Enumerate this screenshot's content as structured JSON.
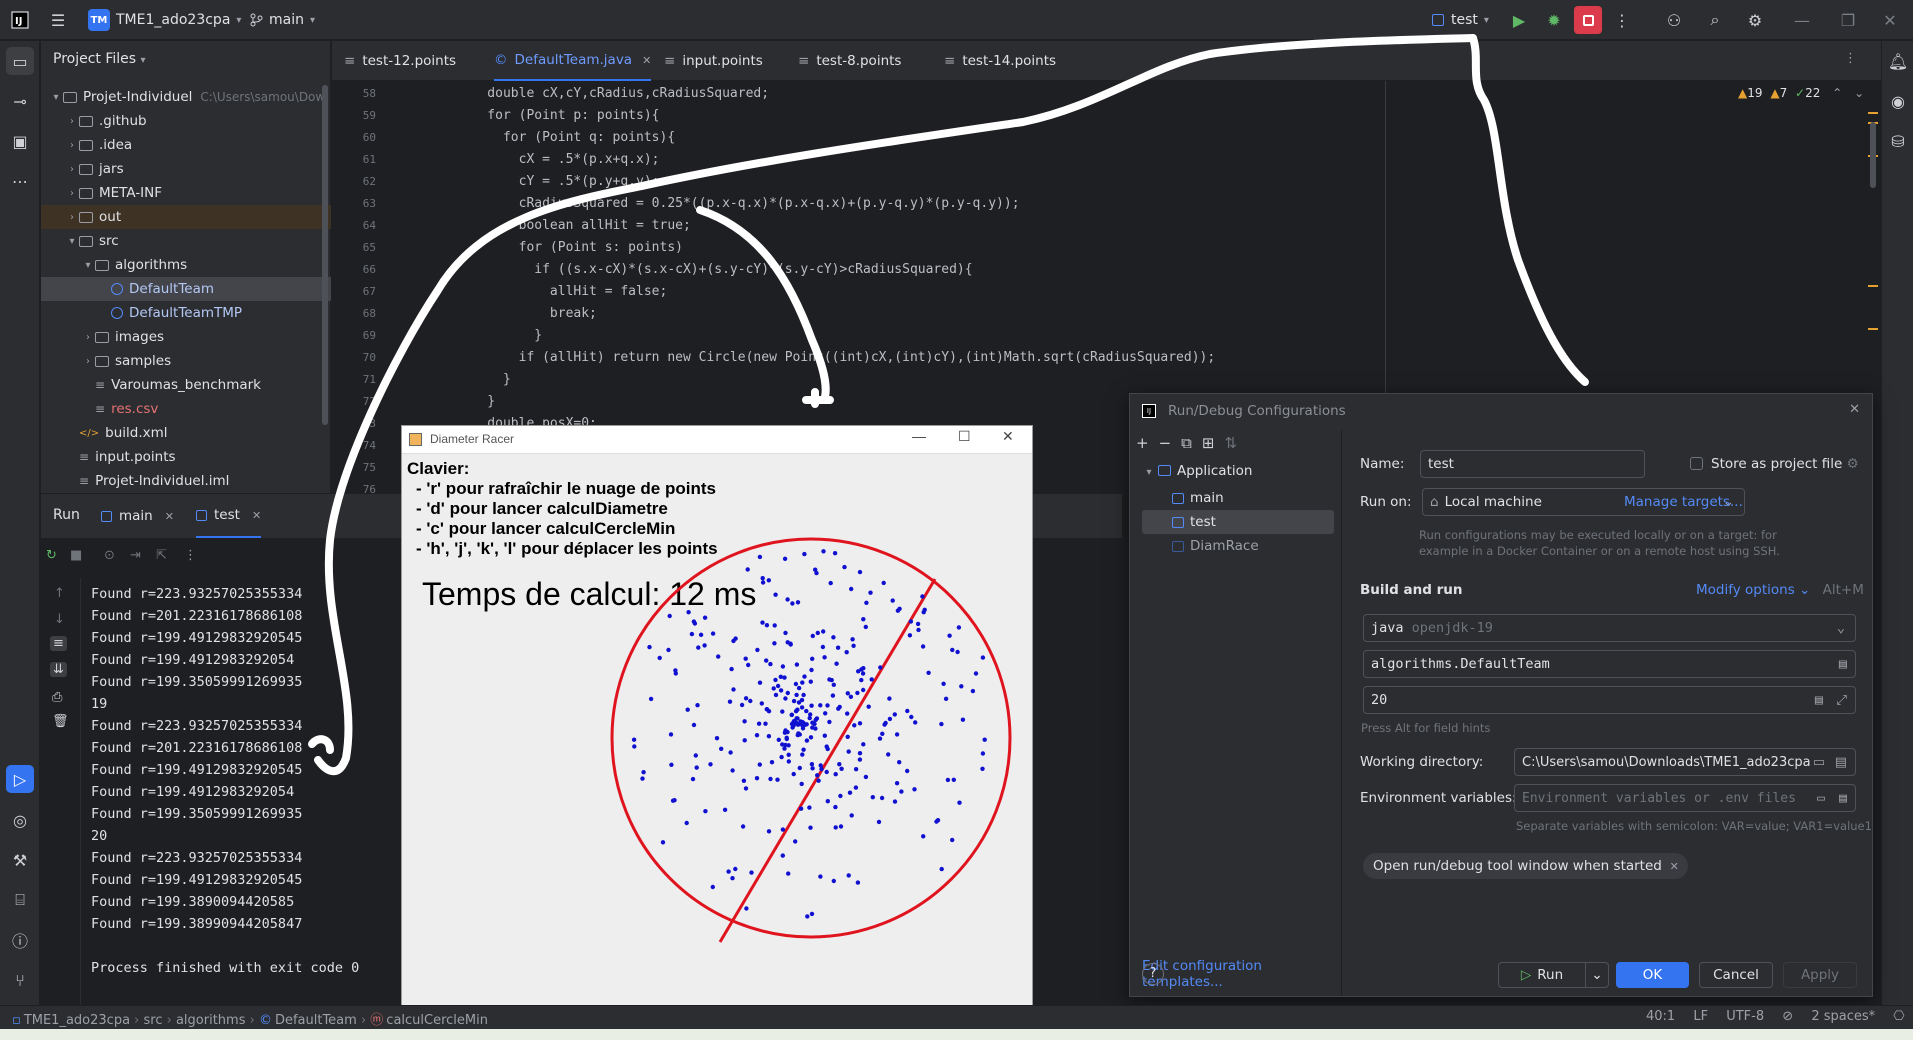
{
  "titlebar": {
    "project_badge": "TM",
    "project_name": "TME1_ado23cpa",
    "branch": "main",
    "run_config": "test",
    "icons": [
      "main-menu-icon",
      "branch-icon",
      "run-icon",
      "debug-icon",
      "stop-icon",
      "more-icon",
      "add-user-icon",
      "search-icon",
      "settings-icon",
      "minimize-icon",
      "maximize-icon",
      "close-icon"
    ]
  },
  "project_panel": {
    "title": "Project Files",
    "tree": [
      {
        "label": "Projet-Individuel",
        "extra": "C:\\Users\\samou\\Dow",
        "depth": 0,
        "kind": "folder",
        "open": true
      },
      {
        "label": ".github",
        "depth": 1,
        "kind": "folder",
        "open": false
      },
      {
        "label": ".idea",
        "depth": 1,
        "kind": "folder",
        "open": false
      },
      {
        "label": "jars",
        "depth": 1,
        "kind": "folder",
        "open": false
      },
      {
        "label": "META-INF",
        "depth": 1,
        "kind": "folder",
        "open": false
      },
      {
        "label": "out",
        "depth": 1,
        "kind": "folder",
        "open": false,
        "highlight": true
      },
      {
        "label": "src",
        "depth": 1,
        "kind": "folder",
        "open": true
      },
      {
        "label": "algorithms",
        "depth": 2,
        "kind": "folder",
        "open": true
      },
      {
        "label": "DefaultTeam",
        "depth": 3,
        "kind": "class",
        "selected": true
      },
      {
        "label": "DefaultTeamTMP",
        "depth": 3,
        "kind": "class"
      },
      {
        "label": "images",
        "depth": 2,
        "kind": "folder",
        "open": false
      },
      {
        "label": "samples",
        "depth": 2,
        "kind": "folder",
        "open": false
      },
      {
        "label": "Varoumas_benchmark",
        "depth": 2,
        "kind": "file"
      },
      {
        "label": "res.csv",
        "depth": 2,
        "kind": "csv"
      },
      {
        "label": "build.xml",
        "depth": 1,
        "kind": "xml"
      },
      {
        "label": "input.points",
        "depth": 1,
        "kind": "file"
      },
      {
        "label": "Projet-Individuel.iml",
        "depth": 1,
        "kind": "file"
      }
    ]
  },
  "editor": {
    "tabs": [
      "test-12.points",
      "DefaultTeam.java",
      "input.points",
      "test-8.points",
      "test-14.points"
    ],
    "active_tab": 1,
    "inspections": {
      "warnings": "19",
      "weak": "7",
      "typos": "22"
    },
    "lines": [
      {
        "n": "58",
        "text": "    double cX,cY,cRadius,cRadiusSquared;"
      },
      {
        "n": "59",
        "text": "    for (Point p: points){"
      },
      {
        "n": "60",
        "text": "      for (Point q: points){"
      },
      {
        "n": "61",
        "text": "        cX = .5*(p.x+q.x);"
      },
      {
        "n": "62",
        "text": "        cY = .5*(p.y+q.y);"
      },
      {
        "n": "63",
        "text": "        cRadiusSquared = 0.25*((p.x-q.x)*(p.x-q.x)+(p.y-q.y)*(p.y-q.y));"
      },
      {
        "n": "64",
        "text": "        boolean allHit = true;"
      },
      {
        "n": "65",
        "text": "        for (Point s: points)"
      },
      {
        "n": "66",
        "text": "          if ((s.x-cX)*(s.x-cX)+(s.y-cY)*(s.y-cY)>cRadiusSquared){"
      },
      {
        "n": "67",
        "text": "            allHit = false;"
      },
      {
        "n": "68",
        "text": "            break;"
      },
      {
        "n": "69",
        "text": "          }"
      },
      {
        "n": "70",
        "text": "        if (allHit) return new Circle(new Point((int)cX,(int)cY),(int)Math.sqrt(cRadiusSquared));"
      },
      {
        "n": "71",
        "text": "      }"
      },
      {
        "n": "72",
        "text": "    }"
      },
      {
        "n": "73",
        "text": "    double posX=0;"
      },
      {
        "n": "74",
        "text": ""
      },
      {
        "n": "75",
        "text": ""
      },
      {
        "n": "76",
        "text": ""
      }
    ]
  },
  "run_panel": {
    "title": "Run",
    "tabs": [
      "main",
      "test"
    ],
    "active_tab": 1,
    "console": [
      "Found r=223.93257025355334",
      "Found r=201.22316178686108",
      "Found r=199.49129832920545",
      "Found r=199.4912983292054",
      "Found r=199.35059991269935",
      "19",
      "Found r=223.93257025355334",
      "Found r=201.22316178686108",
      "Found r=199.49129832920545",
      "Found r=199.4912983292054",
      "Found r=199.35059991269935",
      "20",
      "Found r=223.93257025355334",
      "Found r=199.49129832920545",
      "Found r=199.3890094420585",
      "Found r=199.38990944205847",
      "",
      "Process finished with exit code 0"
    ]
  },
  "swing_window": {
    "title": "Diameter Racer",
    "heading": "Clavier:",
    "instructions": [
      "- 'r' pour rafraîchir le nuage de points",
      "- 'd' pour lancer calculDiametre",
      "- 'c' pour lancer calculCercleMin",
      "- 'h', 'j', 'k', 'l' pour déplacer les points"
    ],
    "timing": "Temps de calcul: 12 ms",
    "circle_color": "#e0141e",
    "point_color": "#1010d0"
  },
  "dialog": {
    "title": "Run/Debug Configurations",
    "tree_group": "Application",
    "tree_items": [
      "main",
      "test",
      "DiamRace"
    ],
    "selected_item": 1,
    "edit_templates": "Edit configuration templates...",
    "name_label": "Name:",
    "name_value": "test",
    "store_label": "Store as project file",
    "run_on_label": "Run on:",
    "run_on_value": "Local machine",
    "manage_targets": "Manage targets...",
    "run_on_hint_1": "Run configurations may be executed locally or on a target: for",
    "run_on_hint_2": "example in a Docker Container or on a remote host using SSH.",
    "build_run_label": "Build and run",
    "modify_options": "Modify options",
    "modify_shortcut": "Alt+M",
    "jdk_prefix": "java",
    "jdk_value": "openjdk-19",
    "main_class": "algorithms.DefaultTeam",
    "program_args": "20",
    "program_args_hint": "Press Alt for field hints",
    "working_dir_label": "Working directory:",
    "working_dir_value": "C:\\Users\\samou\\Downloads\\TME1_ado23cpa",
    "env_label": "Environment variables:",
    "env_placeholder": "Environment variables or .env files",
    "env_hint": "Separate variables with semicolon: VAR=value; VAR1=value1",
    "chip": "Open run/debug tool window when started",
    "btn_run": "Run",
    "btn_ok": "OK",
    "btn_cancel": "Cancel",
    "btn_apply": "Apply",
    "accent": "#3574f0"
  },
  "statusbar": {
    "breadcrumb": [
      "TME1_ado23cpa",
      "src",
      "algorithms",
      "DefaultTeam",
      "calculCercleMin"
    ],
    "position": "40:1",
    "line_sep": "LF",
    "encoding": "UTF-8",
    "indent": "2 spaces*"
  }
}
